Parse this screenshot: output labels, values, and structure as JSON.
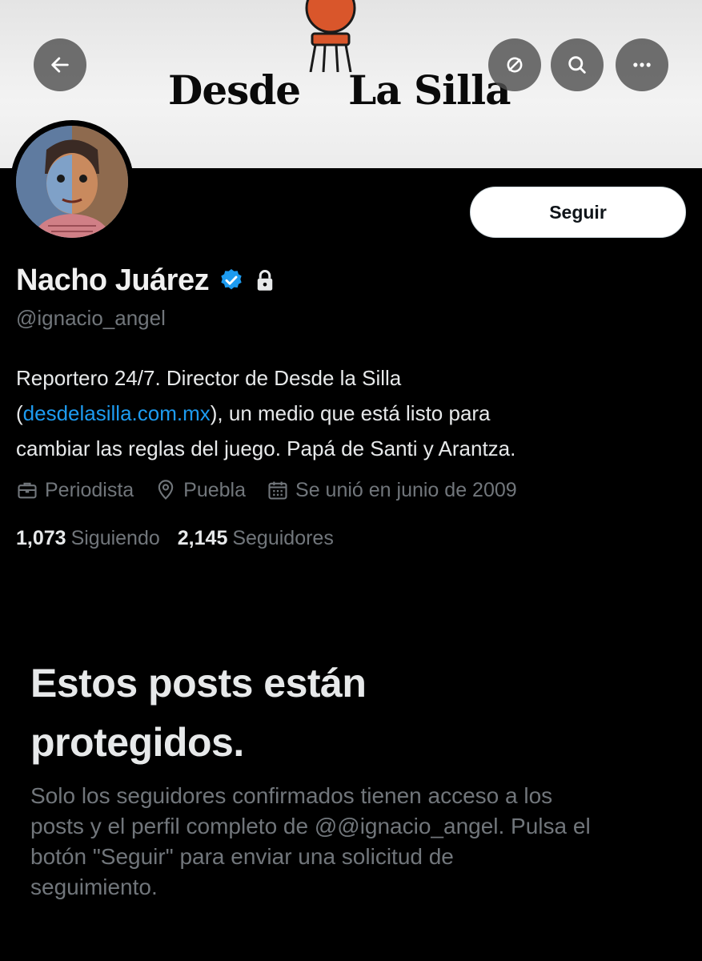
{
  "banner": {
    "logo_left": "Desde",
    "logo_right": "La Silla"
  },
  "header": {
    "back_icon": "arrow-left-icon",
    "grok_icon": "slashed-circle-icon",
    "search_icon": "search-icon",
    "more_icon": "more-horizontal-icon"
  },
  "profile": {
    "follow_label": "Seguir",
    "name": "Nacho Juárez",
    "handle": "@ignacio_angel",
    "bio": {
      "line1": "Reportero 24/7. Director de Desde la Silla",
      "open_paren": "(",
      "link": "desdelasilla.com.mx",
      "line2_rest": "), un medio que está listo para",
      "line3": "cambiar las reglas del juego. Papá de Santi y Arantza."
    },
    "meta": {
      "profession": "Periodista",
      "location": "Puebla",
      "joined": "Se unió en junio de 2009"
    },
    "stats": {
      "following_count": "1,073",
      "following_label": "Siguiendo",
      "followers_count": "2,145",
      "followers_label": "Seguidores"
    }
  },
  "protected": {
    "title_line1": "Estos posts están",
    "title_line2": "protegidos.",
    "desc_line1": "Solo los seguidores confirmados tienen acceso a los",
    "desc_line2": "posts y el perfil completo de @@ignacio_angel. Pulsa el",
    "desc_line3": "botón \"Seguir\" para enviar una solicitud de",
    "desc_line4": "seguimiento."
  },
  "colors": {
    "link": "#1d9bf0",
    "muted": "#71767b",
    "background": "#000000",
    "verified": "#1d9bf0"
  }
}
